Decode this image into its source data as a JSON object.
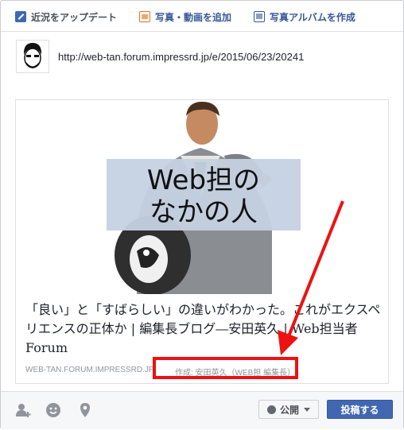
{
  "tabs": {
    "update_label": "近況をアップデート",
    "photo_label": "写真・動画を追加",
    "album_label": "写真アルバムを作成"
  },
  "composer": {
    "url_text": "http://web-tan.forum.impressrd.jp/e/2015/06/23/20241"
  },
  "preview": {
    "thumb_text_line1": "Web担の",
    "thumb_text_line2": "なかの人",
    "title": "「良い」と「すばらしい」の違いがわかった。これがエクスペリエンスの正体か | 編集長ブログ―安田英久 | Web担当者Forum",
    "domain": "WEB-TAN.FORUM.IMPRESSRD.JP",
    "author": "作成: 安田英久（WEB担 編集長）"
  },
  "footer": {
    "audience_label": "公開",
    "post_label": "投稿する"
  },
  "colors": {
    "accent": "#4267b2",
    "annotation": "#ee1111"
  },
  "icons": [
    "pencil-icon",
    "photo-icon",
    "album-icon",
    "tag-friends-icon",
    "feeling-icon",
    "location-icon",
    "globe-icon"
  ]
}
